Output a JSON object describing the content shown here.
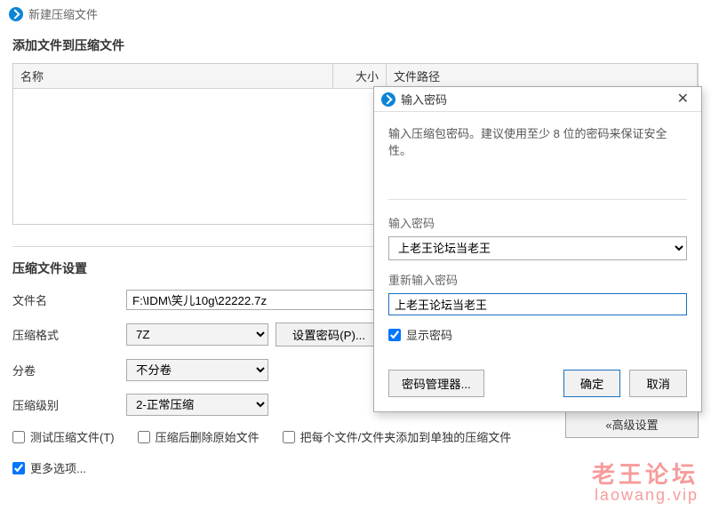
{
  "window": {
    "title": "新建压缩文件"
  },
  "addSection": {
    "heading": "添加文件到压缩文件"
  },
  "table": {
    "headers": {
      "name": "名称",
      "size": "大小",
      "path": "文件路径"
    }
  },
  "settings": {
    "title": "压缩文件设置",
    "filenameLabel": "文件名",
    "filenameValue": "F:\\IDM\\笑儿10g\\22222.7z",
    "formatLabel": "压缩格式",
    "formatValue": "7Z",
    "setPasswordLabel": "设置密码(P)...",
    "splitLabel": "分卷",
    "splitValue": "不分卷",
    "levelLabel": "压缩级别",
    "levelValue": "2-正常压缩",
    "advancedBtn": "«高级设置"
  },
  "checks": {
    "testArchive": "测试压缩文件(T)",
    "deleteAfter": "压缩后删除原始文件",
    "addSeparate": "把每个文件/文件夹添加到单独的压缩文件",
    "moreOptions": "更多选项..."
  },
  "dialog": {
    "title": "输入密码",
    "hint": "输入压缩包密码。建议使用至少 8 位的密码来保证安全性。",
    "passwordLabel": "输入密码",
    "passwordValue": "上老王论坛当老王",
    "rePasswordLabel": "重新输入密码",
    "rePasswordValue": "上老王论坛当老王",
    "showPassword": "显示密码",
    "manager": "密码管理器...",
    "ok": "确定",
    "cancel": "取消"
  },
  "watermark": {
    "line1": "老王论坛",
    "line2": "laowang.vip"
  }
}
